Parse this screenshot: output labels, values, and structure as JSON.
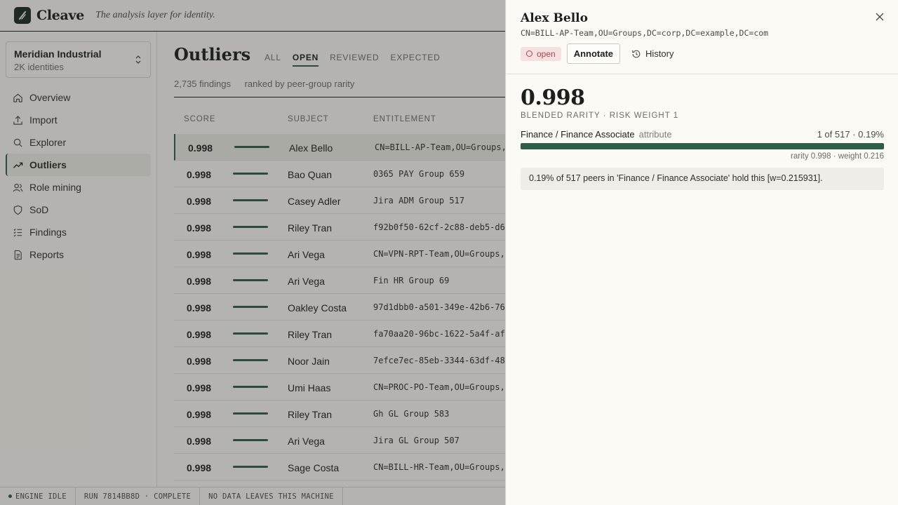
{
  "app": {
    "brand": "Cleave",
    "tagline": "The analysis layer for identity."
  },
  "workspace": {
    "name": "Meridian Industrial",
    "sub": "2K identities"
  },
  "nav": [
    {
      "label": "Overview",
      "icon": "home-icon"
    },
    {
      "label": "Import",
      "icon": "upload-icon"
    },
    {
      "label": "Explorer",
      "icon": "search-icon"
    },
    {
      "label": "Outliers",
      "icon": "trend-icon",
      "active": true
    },
    {
      "label": "Role mining",
      "icon": "users-icon"
    },
    {
      "label": "SoD",
      "icon": "shield-icon"
    },
    {
      "label": "Findings",
      "icon": "list-icon"
    },
    {
      "label": "Reports",
      "icon": "document-icon"
    }
  ],
  "page": {
    "title": "Outliers",
    "tabs": [
      "ALL",
      "OPEN",
      "REVIEWED",
      "EXPECTED"
    ],
    "active_tab": "OPEN",
    "findings_count": "2,735 findings",
    "ranking": "ranked by peer-group rarity"
  },
  "table": {
    "headers": {
      "score": "SCORE",
      "subject": "SUBJECT",
      "entitlement": "ENTITLEMENT"
    },
    "rows": [
      {
        "score": "0.998",
        "subject": "Alex Bello",
        "entitlement": "CN=BILL-AP-Team,OU=Groups,",
        "selected": true
      },
      {
        "score": "0.998",
        "subject": "Bao Quan",
        "entitlement": "0365 PAY Group 659"
      },
      {
        "score": "0.998",
        "subject": "Casey Adler",
        "entitlement": "Jira ADM Group 517"
      },
      {
        "score": "0.998",
        "subject": "Riley Tran",
        "entitlement": "f92b0f50-62cf-2c88-deb5-d6"
      },
      {
        "score": "0.998",
        "subject": "Ari Vega",
        "entitlement": "CN=VPN-RPT-Team,OU=Groups,"
      },
      {
        "score": "0.998",
        "subject": "Ari Vega",
        "entitlement": "Fin HR Group 69"
      },
      {
        "score": "0.998",
        "subject": "Oakley Costa",
        "entitlement": "97d1dbb0-a501-349e-42b6-76"
      },
      {
        "score": "0.998",
        "subject": "Riley Tran",
        "entitlement": "fa70aa20-96bc-1622-5a4f-af"
      },
      {
        "score": "0.998",
        "subject": "Noor Jain",
        "entitlement": "7efce7ec-85eb-3344-63df-48"
      },
      {
        "score": "0.998",
        "subject": "Umi Haas",
        "entitlement": "CN=PROC-PO-Team,OU=Groups,"
      },
      {
        "score": "0.998",
        "subject": "Riley Tran",
        "entitlement": "Gh GL Group 583"
      },
      {
        "score": "0.998",
        "subject": "Ari Vega",
        "entitlement": "Jira GL Group 507"
      },
      {
        "score": "0.998",
        "subject": "Sage Costa",
        "entitlement": "CN=BILL-HR-Team,OU=Groups,"
      }
    ]
  },
  "status": {
    "engine": "ENGINE IDLE",
    "run": "RUN 7814BB8D · COMPLETE",
    "privacy": "NO DATA LEAVES THIS MACHINE"
  },
  "drawer": {
    "name": "Alex Bello",
    "dn": "CN=BILL-AP-Team,OU=Groups,DC=corp,DC=example,DC=com",
    "status_badge": "open",
    "annotate_label": "Annotate",
    "history_label": "History",
    "score": "0.998",
    "score_caption": "BLENDED RARITY · RISK WEIGHT 1",
    "peer_group": "Finance / Finance Associate",
    "peer_kind": "attribute",
    "peer_count": "1 of 517 · 0.19%",
    "peer_meta": "rarity 0.998 · weight 0.216",
    "note": "0.19% of 517 peers in 'Finance / Finance Associate' hold this [w=0.215931]."
  },
  "colors": {
    "accent": "#2c5e48",
    "open_badge_bg": "#f5e1e1",
    "open_badge_fg": "#b94040",
    "background": "#f6f5f0"
  }
}
